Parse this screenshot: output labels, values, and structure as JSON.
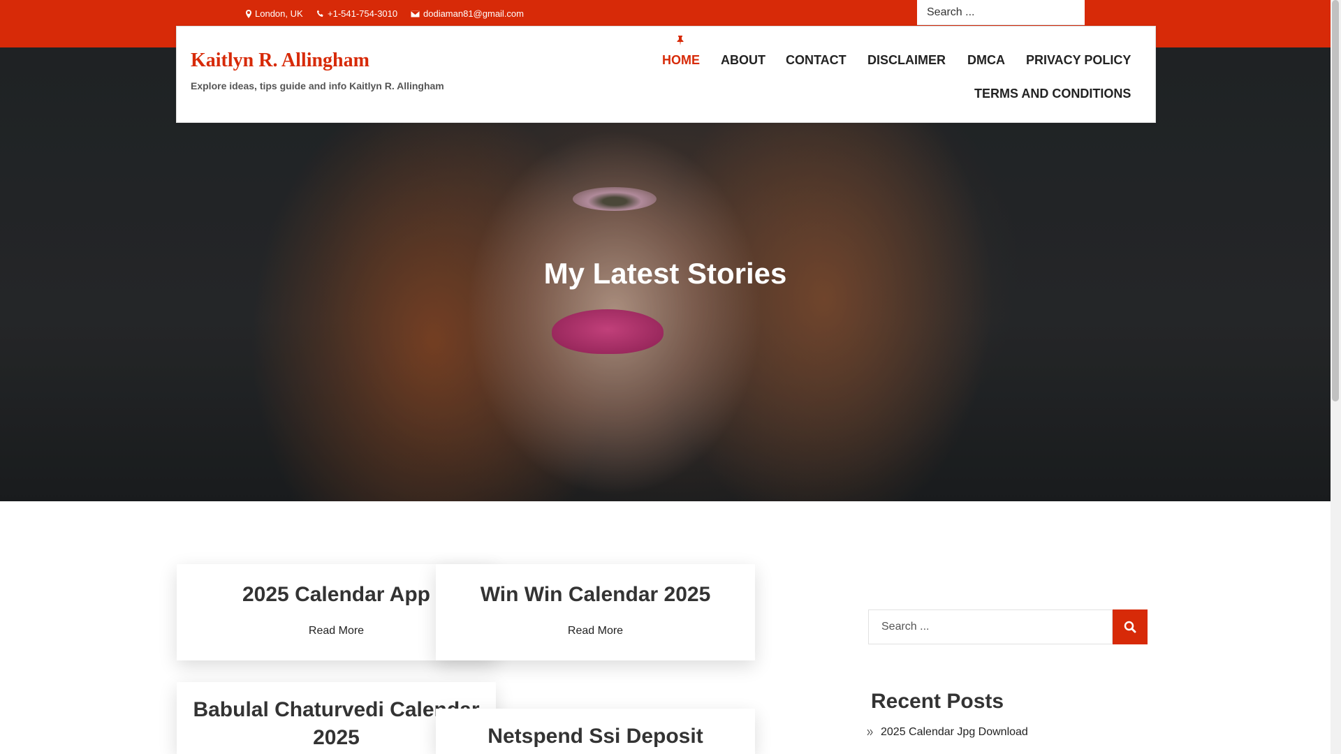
{
  "topbar": {
    "location": "London, UK",
    "phone": "+1-541-754-3010",
    "email": "dodiaman81@gmail.com",
    "search_placeholder": "Search ..."
  },
  "site": {
    "title": "Kaitlyn R. Allingham",
    "tagline": "Explore ideas, tips guide and info Kaitlyn R. Allingham"
  },
  "nav": {
    "items": [
      "HOME",
      "ABOUT",
      "CONTACT",
      "DISCLAIMER",
      "DMCA",
      "PRIVACY POLICY",
      "TERMS AND CONDITIONS"
    ],
    "active": "HOME"
  },
  "hero": {
    "title": "My Latest Stories"
  },
  "posts": [
    {
      "title": "2025 Calendar App",
      "link": "Read More"
    },
    {
      "title": "Win Win Calendar 2025",
      "link": "Read More"
    },
    {
      "title": "Babulal Chaturvedi Calendar 2025"
    },
    {
      "title": "Netspend Ssi Deposit"
    }
  ],
  "sidebar": {
    "search_placeholder": "Search ...",
    "recent_title": "Recent Posts",
    "recent": [
      "2025 Calendar Jpg Download"
    ]
  },
  "colors": {
    "accent": "#d72a08",
    "text": "#333333"
  }
}
